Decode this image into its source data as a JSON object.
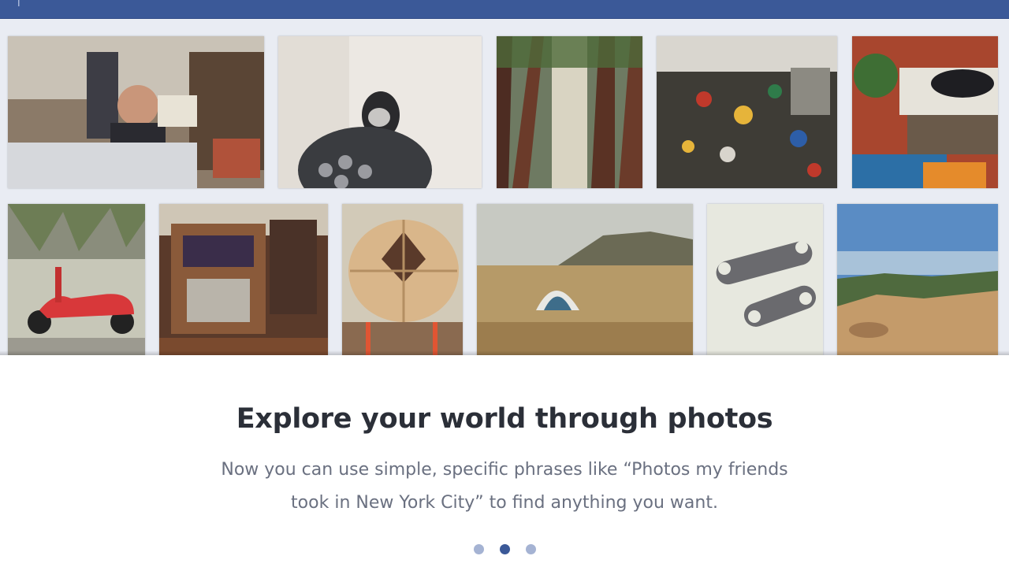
{
  "header": {
    "crumb": "|"
  },
  "main": {
    "headline": "Explore your world through photos",
    "subtext": "Now you can use simple, specific phrases like “Photos my friends took in New York City” to find anything you want."
  },
  "carousel": {
    "total": 3,
    "active_index": 1
  },
  "colors": {
    "brand": "#3b5998",
    "dot_inactive": "#a5b3d3",
    "headline": "#2b2f38",
    "subtext": "#6a7080"
  }
}
